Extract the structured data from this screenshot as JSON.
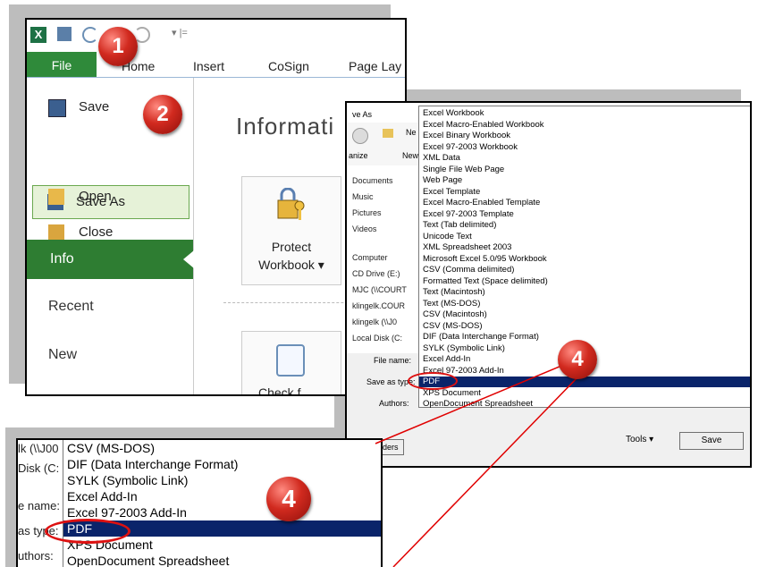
{
  "excel": {
    "ribbon_tabs": [
      "File",
      "Home",
      "Insert",
      "CoSign",
      "Page Lay"
    ],
    "nav": {
      "save": "Save",
      "save_as": "Save As",
      "open": "Open",
      "close": "Close",
      "info": "Info",
      "recent": "Recent",
      "new": "New"
    },
    "info_title": "Informati",
    "protect_label_1": "Protect",
    "protect_label_2": "Workbook",
    "check_label": "Check f"
  },
  "save_as_dialog": {
    "title": "ve As",
    "toolbar": {
      "organize": "anize",
      "new_folder": "New",
      "back_label": "Ne"
    },
    "left_nav": [
      "Documents",
      "Music",
      "Pictures",
      "Videos",
      "Computer",
      "CD Drive (E:)",
      "MJC (\\\\COURT",
      "klingelk.COUR",
      "klingelk (\\\\J0",
      "Local Disk (C:"
    ],
    "labels": {
      "file_name": "File name:",
      "save_as_type": "Save as type:",
      "authors": "Authors:"
    },
    "file_types": [
      "Excel Workbook",
      "Excel Macro-Enabled Workbook",
      "Excel Binary Workbook",
      "Excel 97-2003 Workbook",
      "XML Data",
      "Single File Web Page",
      "Web Page",
      "Excel Template",
      "Excel Macro-Enabled Template",
      "Excel 97-2003 Template",
      "Text (Tab delimited)",
      "Unicode Text",
      "XML Spreadsheet 2003",
      "Microsoft Excel 5.0/95 Workbook",
      "CSV (Comma delimited)",
      "Formatted Text (Space delimited)",
      "Text (Macintosh)",
      "Text (MS-DOS)",
      "CSV (Macintosh)",
      "CSV (MS-DOS)",
      "DIF (Data Interchange Format)",
      "SYLK (Symbolic Link)",
      "Excel Add-In",
      "Excel 97-2003 Add-In",
      "PDF",
      "XPS Document",
      "OpenDocument Spreadsheet"
    ],
    "selected_type": "PDF",
    "hide_folders": "Hide Folders",
    "tools": "Tools",
    "save": "Save"
  },
  "zoom": {
    "left": [
      "lk (\\\\J00",
      "Disk (C:",
      "e name:",
      "as type:",
      "uthors:"
    ],
    "items": [
      "CSV (MS-DOS)",
      "DIF (Data Interchange Format)",
      "SYLK (Symbolic Link)",
      "Excel Add-In",
      "Excel 97-2003 Add-In",
      "PDF",
      "XPS Document",
      "OpenDocument Spreadsheet"
    ],
    "selected": "PDF"
  },
  "badges": {
    "b1": "1",
    "b2": "2",
    "b4a": "4",
    "b4b": "4"
  },
  "colors": {
    "file_green": "#2f8a3a",
    "info_green": "#2e7d32",
    "selection_blue": "#0a246a",
    "badge_red": "#d12a1f",
    "annotation_line": "#e00000"
  }
}
